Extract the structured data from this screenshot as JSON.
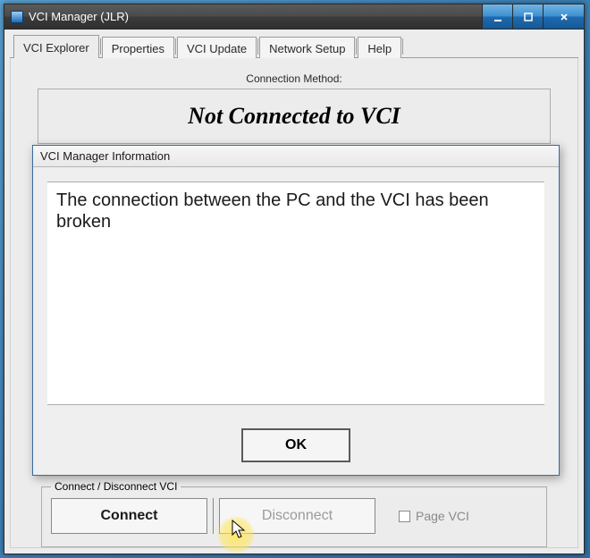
{
  "window": {
    "title": "VCI Manager (JLR)"
  },
  "tabs": [
    {
      "label": "VCI Explorer",
      "active": true
    },
    {
      "label": "Properties",
      "active": false
    },
    {
      "label": "VCI Update",
      "active": false
    },
    {
      "label": "Network Setup",
      "active": false
    },
    {
      "label": "Help",
      "active": false
    }
  ],
  "conn": {
    "method_label": "Connection Method:",
    "status": "Not Connected to VCI"
  },
  "actions": {
    "group_label": "Connect / Disconnect VCI",
    "connect": "Connect",
    "disconnect": "Disconnect",
    "page_vci": "Page VCI"
  },
  "dialog": {
    "title": "VCI Manager Information",
    "message": "The connection between the PC and the VCI has been broken",
    "ok": "OK"
  }
}
